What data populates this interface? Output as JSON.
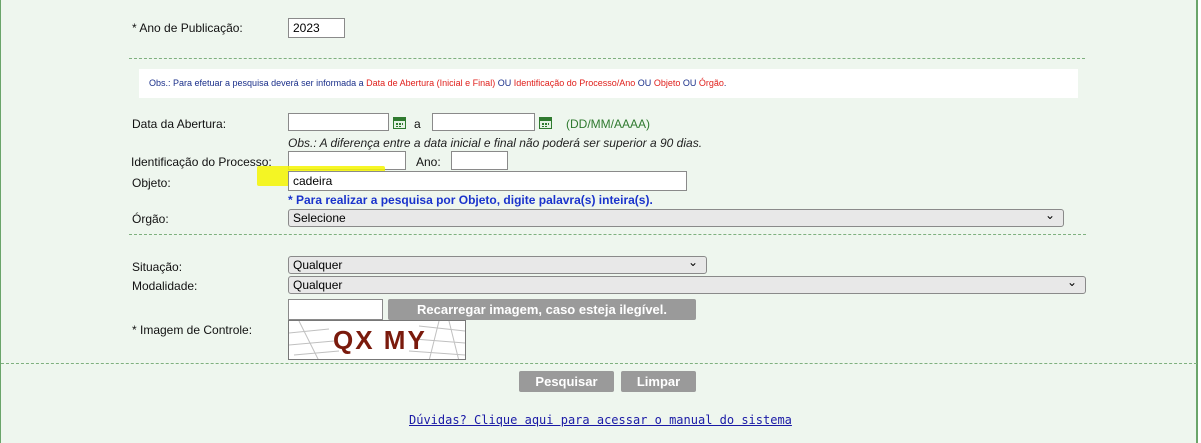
{
  "form": {
    "ano_label": "* Ano de Publicação:",
    "ano_value": "2023",
    "obs_parts": [
      {
        "text": "Obs.: Para efetuar a pesquisa deverá ser informada a ",
        "red": false
      },
      {
        "text": "Data de Abertura (Inicial e Final)",
        "red": true
      },
      {
        "text": " OU ",
        "red": false
      },
      {
        "text": "Identificação do Processo/Ano",
        "red": true
      },
      {
        "text": " OU ",
        "red": false
      },
      {
        "text": "Objeto",
        "red": true
      },
      {
        "text": " OU ",
        "red": false
      },
      {
        "text": "Órgão",
        "red": true
      },
      {
        "text": ".",
        "red": false
      }
    ],
    "data_abertura_label": "Data da Abertura:",
    "data_inicial_value": "",
    "separator_a": "a",
    "data_final_value": "",
    "date_format_hint": "(DD/MM/AAAA)",
    "date_obs": "Obs.: A diferença entre a data inicial e final não poderá ser superior a 90 dias.",
    "identificacao_label": "Identificação do Processo:",
    "identificacao_value": "",
    "ano_processo_label": "Ano:",
    "ano_processo_value": "",
    "objeto_label": "Objeto:",
    "objeto_value": "cadeira",
    "objeto_hint": "* Para realizar a pesquisa por Objeto, digite palavra(s) inteira(s).",
    "orgao_label": "Órgão:",
    "orgao_selected": "Selecione",
    "situacao_label": "Situação:",
    "situacao_selected": "Qualquer",
    "modalidade_label": "Modalidade:",
    "modalidade_selected": "Qualquer",
    "captcha_value": "",
    "reload_button": "Recarregar imagem, caso esteja ilegível.",
    "captcha_label": "* Imagem de Controle:",
    "captcha_text": "QX MY",
    "search_button": "Pesquisar",
    "clear_button": "Limpar",
    "help_link": "Dúvidas? Clique aqui para acessar o manual do sistema"
  },
  "colors": {
    "panel_bg": "#eef6ee",
    "border_green": "#6aa56a",
    "obs_text": "#1a2f8a",
    "obs_red": "#e0201c",
    "hint_blue": "#1a33cc",
    "format_green": "#2f7a2f",
    "button_gray": "#9a9a9a",
    "highlight_yellow": "#f4f400",
    "link_blue": "#1a1aa6",
    "captcha_text": "#7a1a0c"
  },
  "icons": [
    "calendar-icon",
    "chevron-down-icon"
  ]
}
